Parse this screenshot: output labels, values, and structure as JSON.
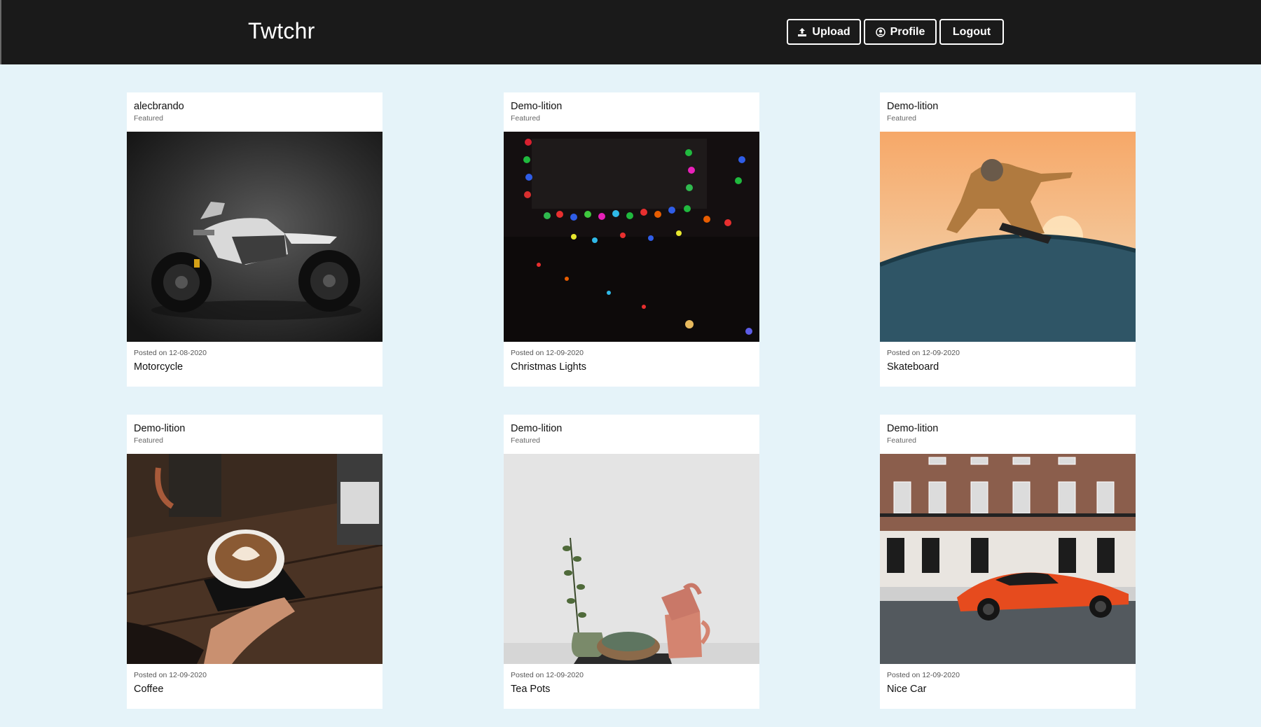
{
  "app": {
    "brand": "Twtchr"
  },
  "nav": {
    "upload_label": "Upload",
    "profile_label": "Profile",
    "logout_label": "Logout"
  },
  "posts": [
    {
      "user": "alecbrando",
      "badge": "Featured",
      "image": "motorcycle",
      "date": "Posted on 12-08-2020",
      "title": "Motorcycle"
    },
    {
      "user": "Demo-lition",
      "badge": "Featured",
      "image": "christmas-lights",
      "date": "Posted on 12-09-2020",
      "title": "Christmas Lights"
    },
    {
      "user": "Demo-lition",
      "badge": "Featured",
      "image": "skateboard",
      "date": "Posted on 12-09-2020",
      "title": "Skateboard"
    },
    {
      "user": "Demo-lition",
      "badge": "Featured",
      "image": "coffee",
      "date": "Posted on 12-09-2020",
      "title": "Coffee"
    },
    {
      "user": "Demo-lition",
      "badge": "Featured",
      "image": "tea-pots",
      "date": "Posted on 12-09-2020",
      "title": "Tea Pots"
    },
    {
      "user": "Demo-lition",
      "badge": "Featured",
      "image": "nice-car",
      "date": "Posted on 12-09-2020",
      "title": "Nice Car"
    }
  ],
  "colors": {
    "navbar": "#1a1a1a",
    "page_background": "#e5f3f9",
    "card": "#ffffff"
  }
}
